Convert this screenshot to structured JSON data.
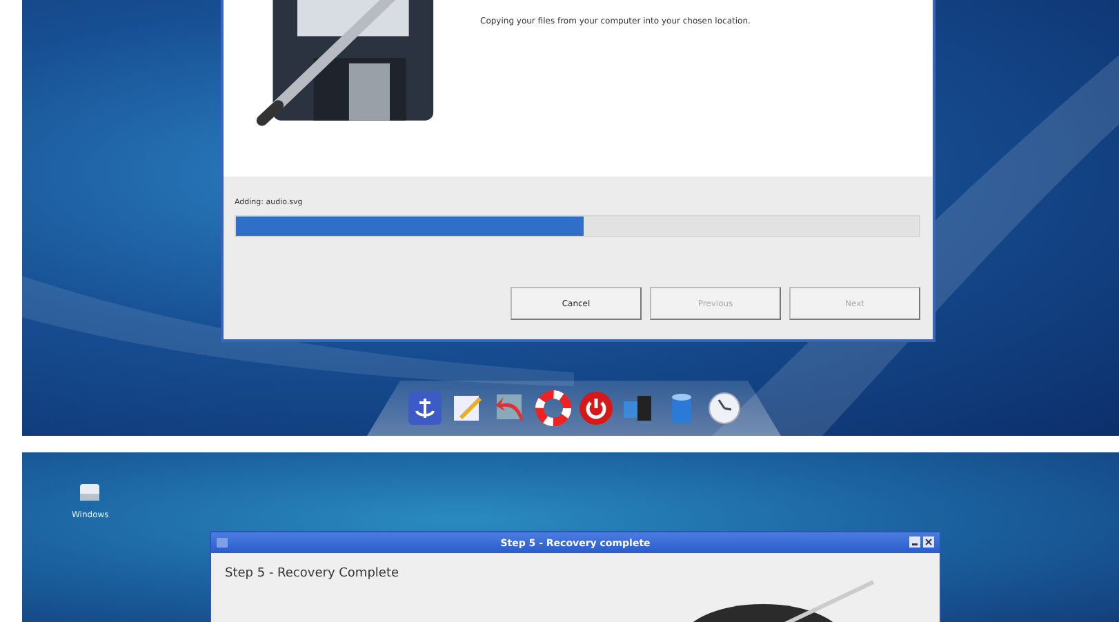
{
  "top_screenshot": {
    "dialog": {
      "description": "Copying your files from your computer into your chosen location.",
      "status": "Adding: audio.svg",
      "progress": {
        "level": 0.51
      },
      "buttons": [
        {
          "label": "Cancel",
          "disabled": false
        },
        {
          "label": "Previous",
          "disabled": true
        },
        {
          "label": "Next",
          "disabled": true
        }
      ]
    }
  },
  "bottom_screenshot": {
    "desktop_icons": [
      {
        "label": "Windows"
      }
    ],
    "window": {
      "title": "Step 5 - Recovery complete",
      "heading": "Step 5 - Recovery Complete"
    }
  }
}
